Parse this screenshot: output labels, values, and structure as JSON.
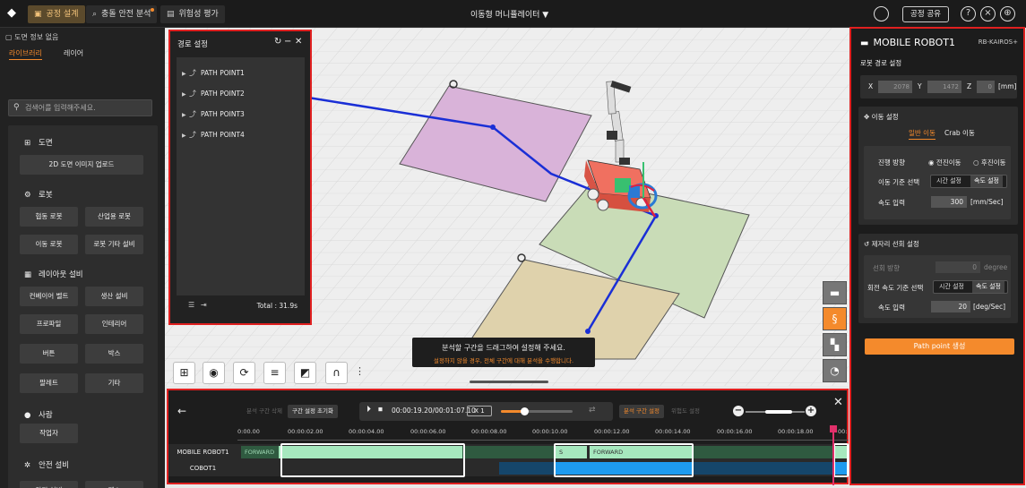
{
  "topbar": {
    "tabs": [
      {
        "label": "공정 설계",
        "icon": "layout-icon",
        "active": true
      },
      {
        "label": "충돌 안전 분석",
        "icon": "collision-icon",
        "active": false,
        "badge": true
      },
      {
        "label": "위험성 평가",
        "icon": "document-icon",
        "active": false
      }
    ],
    "center_title": "이동형 머니퓰레이터",
    "share_label": "공정 공유"
  },
  "left_panel": {
    "header": "도면 정보 없음",
    "tabs": [
      "라이브러리",
      "레이어"
    ],
    "search_placeholder": "검색어를 입력해주세요.",
    "sections": [
      {
        "title": "도면",
        "icon": "blueprint-icon",
        "buttons": [
          "2D 도면 이미지 업로드"
        ]
      },
      {
        "title": "로봇",
        "icon": "robot-arm-icon",
        "buttons": [
          "협동 로봇",
          "산업용 로봇",
          "이동 로봇",
          "로봇 기타 설비"
        ]
      },
      {
        "title": "레이아웃 설비",
        "icon": "grid-icon",
        "buttons": [
          "컨베이어 벨트",
          "생산 설비",
          "프로파일",
          "인테리어",
          "버튼",
          "박스",
          "팔레트",
          "기타"
        ]
      },
      {
        "title": "사람",
        "icon": "person-icon",
        "buttons": [
          "작업자"
        ]
      },
      {
        "title": "안전 설비",
        "icon": "gear-icon",
        "buttons": [
          "안전 설비",
          "펜스"
        ]
      }
    ]
  },
  "path_panel": {
    "title": "경로 설정",
    "items": [
      "PATH POINT1",
      "PATH POINT2",
      "PATH POINT3",
      "PATH POINT4"
    ],
    "total": "Total : 31.9s"
  },
  "tooltip": {
    "line1": "분석할 구간을 드래그하여 설정해 주세요.",
    "line2": "설정하지 않을 경우, 전체 구간에 대해 분석을 수행합니다."
  },
  "timeline": {
    "btn_delete": "분석 구간 삭제",
    "btn_reset": "구간 설정 초기화",
    "time": "00:00:19.20/00:01:07.10",
    "speed": "X 1",
    "btn_analysis": "분석 구간 설정",
    "btn_danger": "위험도 설정",
    "ticks": [
      "0:00.00",
      "00:00:02.00",
      "00:00:04.00",
      "00:00:06.00",
      "00:00:08.00",
      "00:00:10.00",
      "00:00:12.00",
      "00:00:14.00",
      "00:00:16.00",
      "00:00:18.00",
      "00:"
    ],
    "tracks": [
      "MOBILE ROBOT1",
      "COBOT1"
    ],
    "forward_label": "FORWARD",
    "s_label": "S"
  },
  "right_panel": {
    "title": "MOBILE ROBOT1",
    "model": "RB-KAIROS+",
    "path_setting": "로봇 경로 설정",
    "coords": {
      "x": "2078",
      "y": "1472",
      "z": "0",
      "unit": "[mm]"
    },
    "move": {
      "title": "이동 설정",
      "tabs": [
        "일반 이동",
        "Crab 이동"
      ],
      "direction_label": "진행 방향",
      "dir_forward": "◉ 전진이동",
      "dir_backward": "○ 후진이동",
      "criteria_label": "이동 기준 선택",
      "opt_time": "시간 설정",
      "opt_speed": "속도 설정",
      "speed_label": "속도 입력",
      "speed_value": "300",
      "speed_unit": "[mm/Sec]"
    },
    "rotate": {
      "title": "제자리 선회 설정",
      "dir_label": "선회 방향",
      "dir_value": "0",
      "dir_unit": "degree",
      "criteria_label": "회전 속도 기준 선택",
      "opt_time": "시간 설정",
      "opt_speed": "속도 설정",
      "speed_label": "속도 입력",
      "speed_value": "20",
      "speed_unit": "[deg/Sec]"
    },
    "generate_label": "Path point 생성"
  },
  "colors": {
    "accent": "#f48a2c",
    "highlight": "#e02020",
    "path": "#1a2fd6"
  }
}
